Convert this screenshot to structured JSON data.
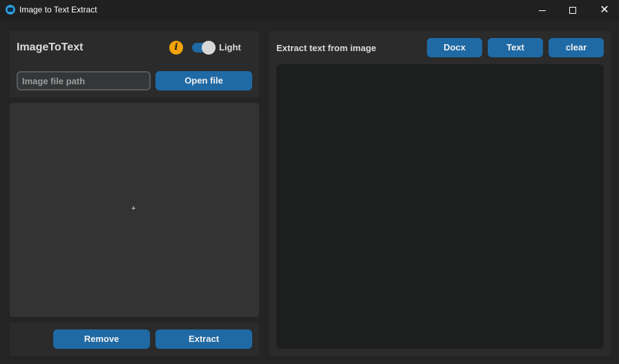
{
  "window": {
    "title": "Image to Text Extract",
    "minimize_glyph": "",
    "close_glyph": "✕"
  },
  "header": {
    "app_name": "ImageToText",
    "info_glyph": "i",
    "theme_switch": {
      "label": "Light",
      "state": "on"
    }
  },
  "file_select": {
    "path_placeholder": "Image file path",
    "path_value": "",
    "open_button": "Open file"
  },
  "image_area": {
    "cursor_glyph": "+"
  },
  "actions": {
    "remove_button": "Remove",
    "extract_button": "Extract"
  },
  "output": {
    "heading": "Extract text from image",
    "docx_button": "Docx",
    "text_button": "Text",
    "clear_button": "clear",
    "text": ""
  },
  "colors": {
    "accent": "#1f6aa5",
    "info": "#f0a30a",
    "background": "#242424",
    "panel": "#2b2b2b"
  },
  "icons": [
    "app-icon",
    "info-icon",
    "minimize-icon",
    "maximize-icon",
    "close-icon"
  ]
}
